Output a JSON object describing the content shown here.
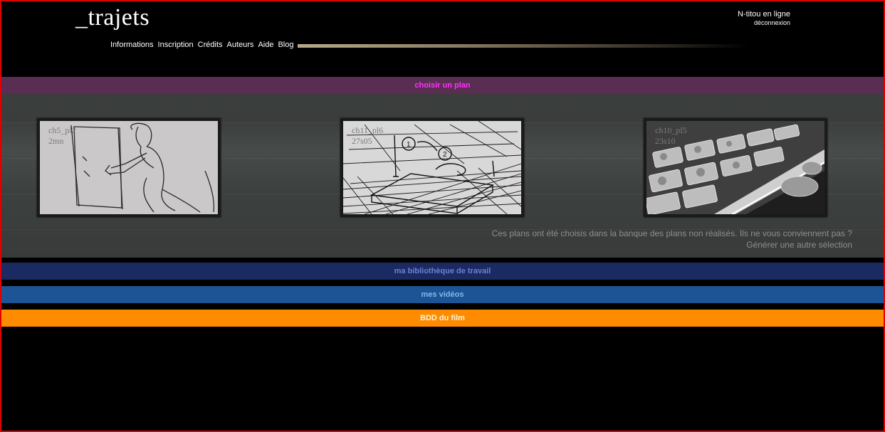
{
  "header": {
    "logo": "_trajets",
    "user_status": "N-titou en ligne",
    "logout": "déconnexion",
    "nav": [
      "Informations",
      "Inscription",
      "Crédits",
      "Auteurs",
      "Aide",
      "Blog"
    ]
  },
  "sections": {
    "choose_plan": "choisir un plan",
    "library": "ma bibliothèque de travail",
    "videos": "mes vidéos",
    "database": "BDD du film"
  },
  "plans": [
    {
      "id": "ch5_pl2",
      "duration": "2mn"
    },
    {
      "id": "ch11_pl6",
      "duration": "27s05"
    },
    {
      "id": "ch10_pl5",
      "duration": "23s10"
    }
  ],
  "note": {
    "text": "Ces plans ont été choisis dans la banque des plans non réalisés. Ils ne vous conviennent pas ?",
    "generate": "Générer une autre sélection"
  }
}
